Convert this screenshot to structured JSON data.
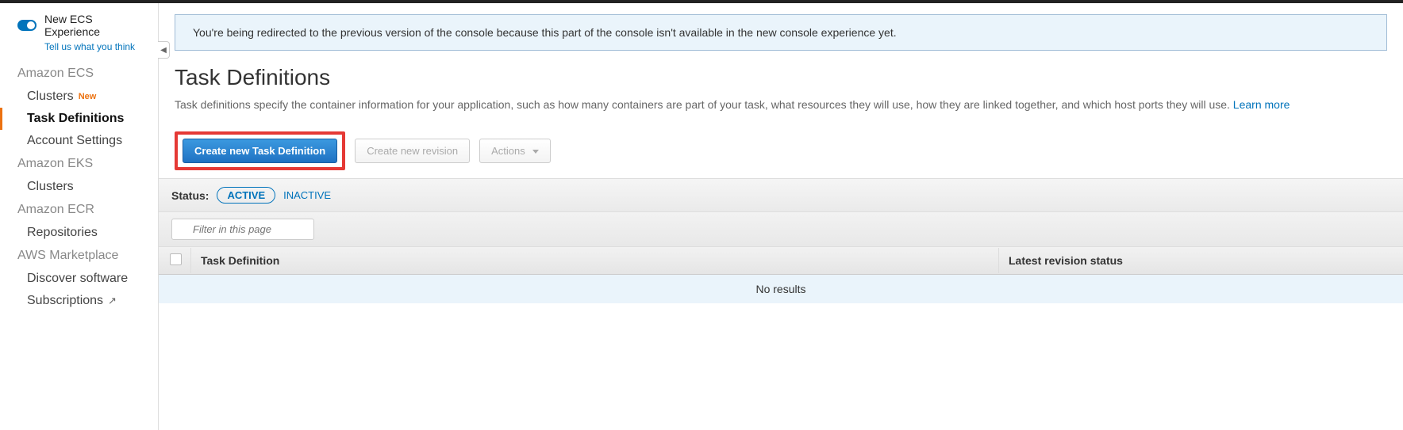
{
  "top_toggle": {
    "label": "New ECS Experience",
    "feedback": "Tell us what you think"
  },
  "sidebar": {
    "groups": [
      {
        "label": "Amazon ECS",
        "items": [
          {
            "label": "Clusters",
            "badge": "New"
          },
          {
            "label": "Task Definitions",
            "active": true
          },
          {
            "label": "Account Settings"
          }
        ]
      },
      {
        "label": "Amazon EKS",
        "items": [
          {
            "label": "Clusters"
          }
        ]
      },
      {
        "label": "Amazon ECR",
        "items": [
          {
            "label": "Repositories"
          }
        ]
      },
      {
        "label": "AWS Marketplace",
        "items": [
          {
            "label": "Discover software"
          },
          {
            "label": "Subscriptions",
            "external": true
          }
        ]
      }
    ]
  },
  "banner": "You're being redirected to the previous version of the console because this part of the console isn't available in the new console experience yet.",
  "page": {
    "title": "Task Definitions",
    "description": "Task definitions specify the container information for your application, such as how many containers are part of your task, what resources they will use, how they are linked together, and which host ports they will use.",
    "learn_more": "Learn more"
  },
  "actions": {
    "create_task_def": "Create new Task Definition",
    "create_revision": "Create new revision",
    "actions_menu": "Actions"
  },
  "status": {
    "label": "Status:",
    "active": "ACTIVE",
    "inactive": "INACTIVE"
  },
  "filter": {
    "placeholder": "Filter in this page"
  },
  "table": {
    "col_task_def": "Task Definition",
    "col_latest_rev": "Latest revision status",
    "no_results": "No results"
  }
}
